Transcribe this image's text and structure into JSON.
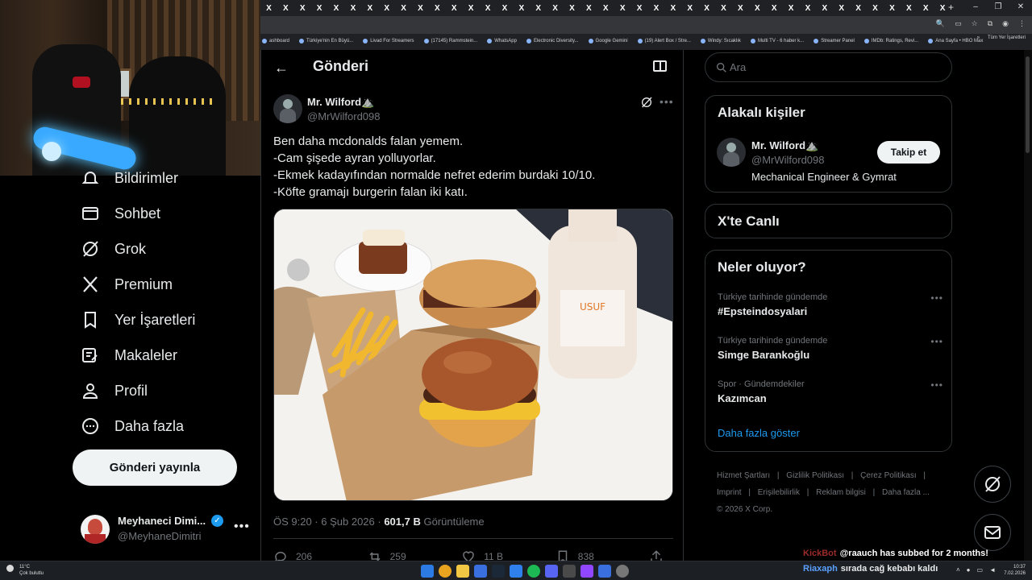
{
  "browser": {
    "tabs": [
      "X",
      "X",
      "X",
      "X",
      "X",
      "X",
      "X",
      "X",
      "X",
      "X",
      "X",
      "X",
      "X",
      "X",
      "X",
      "X",
      "X",
      "X",
      "X",
      "X",
      "X",
      "X",
      "X",
      "X",
      "X",
      "X",
      "X",
      "X",
      "X",
      "X",
      "X",
      "X",
      "X",
      "X",
      "X",
      "X",
      "X",
      "X",
      "X",
      "X",
      "X"
    ],
    "new_tab": "+",
    "window_controls": [
      "–",
      "❐",
      "✕"
    ],
    "bookmarks": [
      "ashboard",
      "Türkiye'nin En Büyü...",
      "Livad For Streamers",
      "(17145) Rammstein...",
      "WhatsApp",
      "Electronic Diversity...",
      "Google Gemini",
      "(19) Alert Box / Stre...",
      "Windy: Sıcaklık",
      "Multi TV - 6 haber k...",
      "Streamer Panel",
      "IMDb: Ratings, Revi...",
      "Ana Sayfa • HBO Max"
    ],
    "bookmarks_overflow": "»",
    "bookmarks_all": "Tüm Yer İşaretleri"
  },
  "nav": {
    "items": [
      {
        "label": "Bildirimler",
        "icon": "bell-icon"
      },
      {
        "label": "Sohbet",
        "icon": "mail-icon"
      },
      {
        "label": "Grok",
        "icon": "grok-icon"
      },
      {
        "label": "Premium",
        "icon": "x-logo-icon"
      },
      {
        "label": "Yer İşaretleri",
        "icon": "bookmark-icon"
      },
      {
        "label": "Makaleler",
        "icon": "article-icon"
      },
      {
        "label": "Profil",
        "icon": "person-icon"
      },
      {
        "label": "Daha fazla",
        "icon": "more-circle-icon"
      }
    ],
    "post_button": "Gönderi yayınla",
    "account": {
      "name": "Meyhaneci Dimi...",
      "handle": "@MeyhaneDimitri",
      "more": "•••"
    }
  },
  "main": {
    "title": "Gönderi",
    "tweet": {
      "author_name": "Mr. Wilford",
      "author_emoji": "⛰️",
      "author_handle": "@MrWilford098",
      "lines": [
        "Ben daha mcdonalds falan yemem.",
        "-Cam şişede ayran yolluyorlar.",
        "-Ekmek kadayıfından normalde nefret ederim burdaki 10/10.",
        "-Köfte gramajı burgerin falan iki katı."
      ],
      "time": "ÖS 9:20 · 6 Şub 2026 · ",
      "views": "601,7 B",
      "views_label": " Görüntüleme",
      "replies": "206",
      "reposts": "259",
      "likes": "11 B",
      "bookmarks": "838"
    }
  },
  "right": {
    "search_placeholder": "Ara",
    "related_title": "Alakalı kişiler",
    "related": {
      "name": "Mr. Wilford",
      "emoji": "⛰️",
      "handle": "@MrWilford098",
      "bio": "Mechanical Engineer & Gymrat",
      "follow": "Takip et"
    },
    "live_title": "X'te Canlı",
    "trends_title": "Neler oluyor?",
    "trends": [
      {
        "context": "Türkiye tarihinde gündemde",
        "title": "#Epsteindosyalari"
      },
      {
        "context": "Türkiye tarihinde gündemde",
        "title": "Simge Barankoğlu"
      },
      {
        "context": "Spor · Gündemdekiler",
        "title": "Kazımcan"
      }
    ],
    "show_more": "Daha fazla göster",
    "footer": [
      "Hizmet Şartları",
      "|",
      "Gizlilik Politikası",
      "|",
      "Çerez Politikası",
      "|",
      "Imprint",
      "|",
      "Erişilebilirlik",
      "|",
      "Reklam bilgisi",
      "|",
      "Daha fazla ...",
      "© 2026 X Corp."
    ]
  },
  "overlay": {
    "alert_user": "KickBot",
    "alert_text": "@raauch has subbed for 2 months!",
    "chat_user": "Riaxaph",
    "chat_text": "sırada cağ kebabı kaldı"
  },
  "taskbar": {
    "temperature": "11°C",
    "weather": "Çok bulutlu",
    "time": "10:37",
    "date": "7.02.2026"
  }
}
